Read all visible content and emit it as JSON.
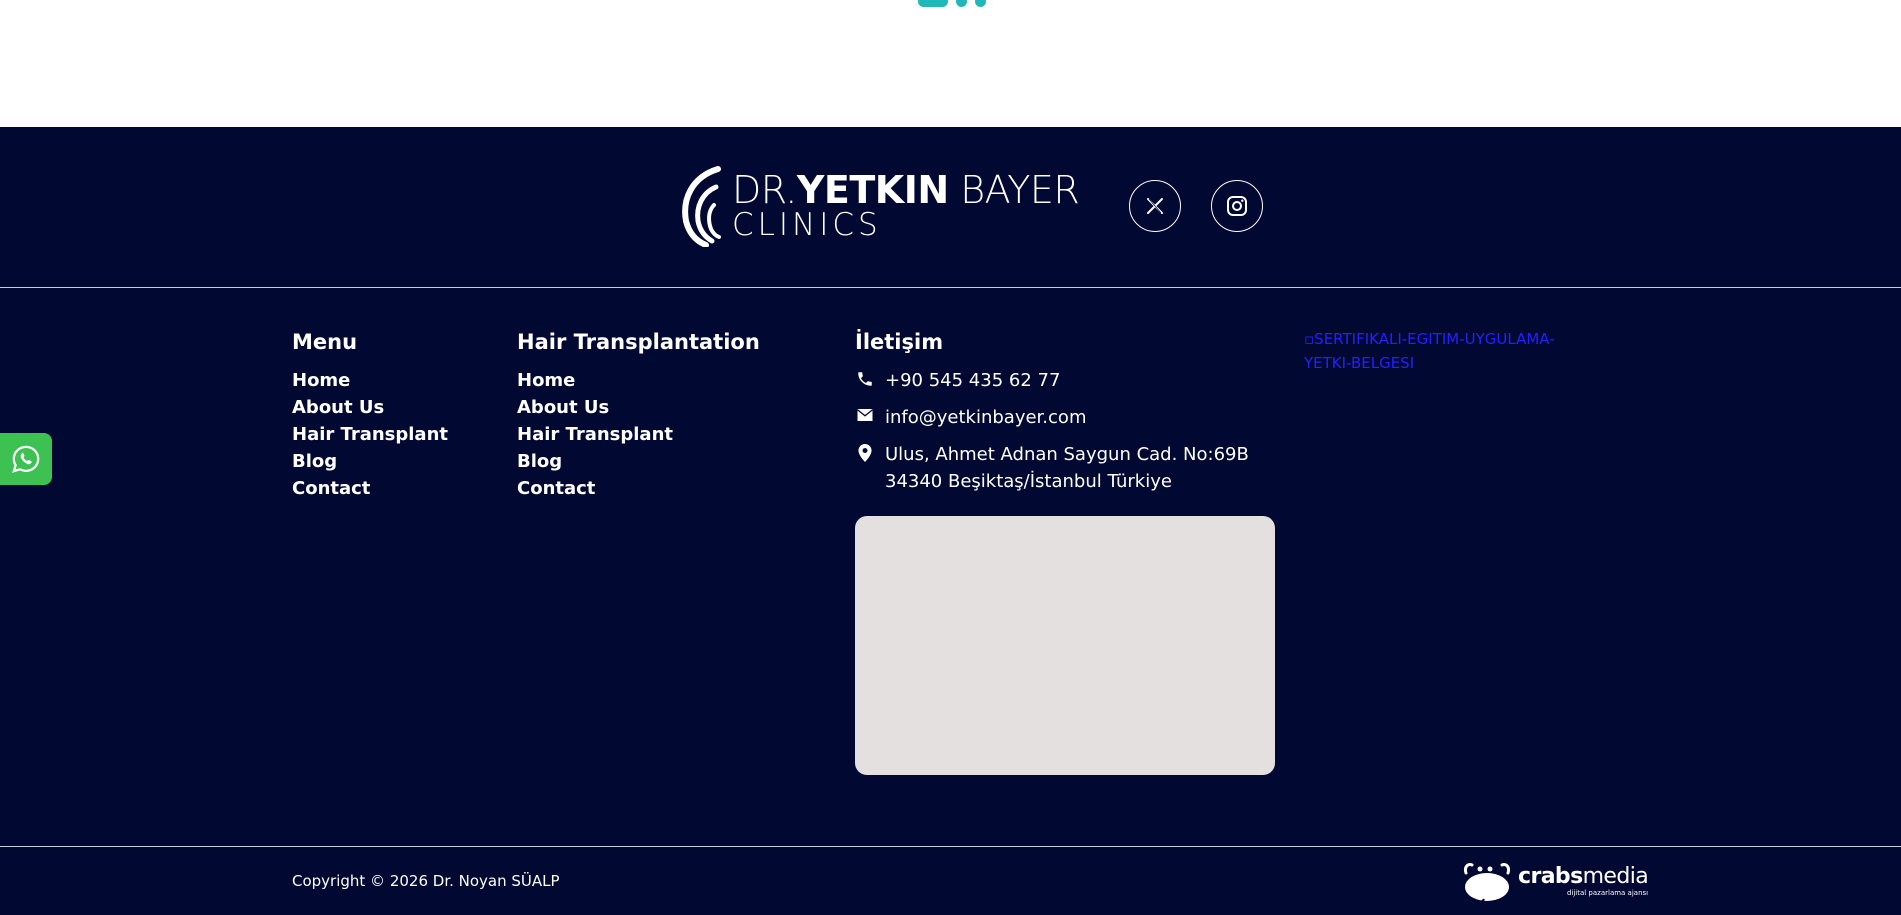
{
  "brand": {
    "line1_light": "DR.",
    "line1_bold": "YETKIN",
    "line1_rest": " BAYER",
    "line2": "CLINICS"
  },
  "social": {
    "icons": [
      "x-icon",
      "instagram-icon"
    ]
  },
  "menu": {
    "title": "Menu",
    "items": [
      "Home",
      "About Us",
      "Hair Transplant",
      "Blog",
      "Contact"
    ]
  },
  "hair": {
    "title": "Hair Transplantation",
    "items": [
      "Home",
      "About Us",
      "Hair Transplant",
      "Blog",
      "Contact"
    ]
  },
  "contact": {
    "title": "İletişim",
    "phone": "+90 545 435 62 77",
    "email": "info@yetkinbayer.com",
    "address_line1": "Ulus, Ahmet Adnan Saygun Cad. No:69B",
    "address_line2": "34340 Beşiktaş/İstanbul Türkiye"
  },
  "certificate_alt": "SERTIFIKALI-EGITIM-UYGULAMA-YETKI-BELGESI",
  "copyright": "Copyright © 2026 Dr. Noyan SÜALP",
  "agency": {
    "name_bold": "crabs",
    "name_light": "media",
    "tagline": "dijital pazarlama ajansı"
  },
  "colors": {
    "footer_bg": "#010932",
    "accent_teal": "#21b7b9",
    "whatsapp_green": "#3cc152",
    "map_placeholder": "#e5e0e0",
    "broken_link_blue": "#2222ff"
  }
}
